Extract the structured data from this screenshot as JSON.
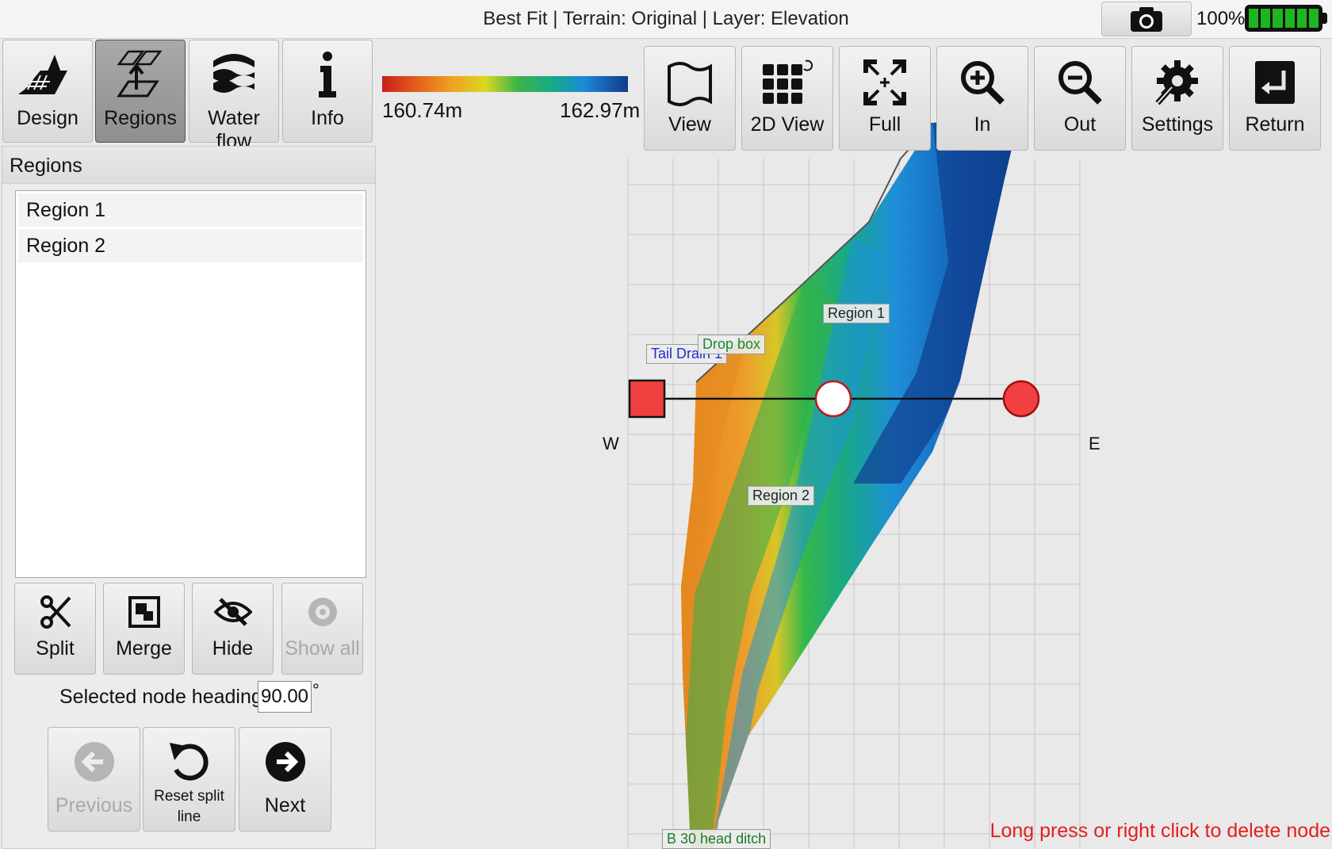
{
  "title": "Best Fit | Terrain: Original | Layer: Elevation",
  "status": {
    "battery_percent": "100%",
    "camera_icon": "camera-icon",
    "battery_icon": "battery-charging-icon"
  },
  "tabs": [
    {
      "label": "Design",
      "icon": "design-icon",
      "active": false
    },
    {
      "label": "Regions",
      "icon": "regions-icon",
      "active": true
    },
    {
      "label": "Water flow",
      "icon": "water-flow-icon",
      "active": false
    },
    {
      "label": "Info",
      "icon": "info-icon",
      "active": false
    }
  ],
  "panel": {
    "title": "Regions",
    "regions": [
      "Region 1",
      "Region 2"
    ],
    "actions": [
      {
        "label": "Split",
        "icon": "scissors-icon",
        "enabled": true
      },
      {
        "label": "Merge",
        "icon": "merge-icon",
        "enabled": true
      },
      {
        "label": "Hide",
        "icon": "eye-slash-icon",
        "enabled": true
      },
      {
        "label": "Show all",
        "icon": "eye-icon",
        "enabled": false
      }
    ],
    "heading_label": "Selected node heading:",
    "heading_value": "90.00",
    "heading_unit": "°",
    "nav": {
      "previous": {
        "label": "Previous",
        "enabled": false
      },
      "reset": {
        "label_line1": "Reset split",
        "label_line2": "line"
      },
      "next": {
        "label": "Next"
      }
    }
  },
  "legend": {
    "min": "160.74m",
    "max": "162.97m"
  },
  "toolbar": [
    {
      "label": "View",
      "icon": "map-icon"
    },
    {
      "label": "2D View",
      "icon": "grid-icon"
    },
    {
      "label": "Full",
      "icon": "fullscreen-icon"
    },
    {
      "label": "In",
      "icon": "zoom-in-icon"
    },
    {
      "label": "Out",
      "icon": "zoom-out-icon"
    },
    {
      "label": "Settings",
      "icon": "settings-icon"
    },
    {
      "label": "Return",
      "icon": "return-icon"
    }
  ],
  "map": {
    "labels": {
      "region1": "Region 1",
      "region2": "Region 2",
      "tail_drain": "Tail Drain 1",
      "drop_box": "Drop box",
      "head_ditch": "B 30 head ditch"
    },
    "compass_w": "W",
    "compass_e": "E",
    "colors": {
      "start_node": "#f04040",
      "mid_node": "#ffffff",
      "end_node": "#f04040"
    }
  },
  "hint": "Long press or right click to delete node"
}
